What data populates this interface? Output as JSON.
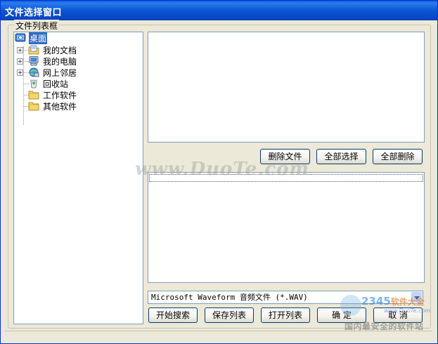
{
  "window": {
    "title": "文件选择窗口"
  },
  "group": {
    "label": "文件列表框"
  },
  "tree": {
    "items": [
      {
        "label": "桌面",
        "icon": "desktop-icon",
        "selected": true
      },
      {
        "label": "我的文档",
        "icon": "documents-folder-icon",
        "expandable": true
      },
      {
        "label": "我的电脑",
        "icon": "computer-icon",
        "expandable": true
      },
      {
        "label": "网上邻居",
        "icon": "network-icon",
        "expandable": true
      },
      {
        "label": "回收站",
        "icon": "recycle-bin-icon"
      },
      {
        "label": "工作软件",
        "icon": "folder-icon"
      },
      {
        "label": "其他软件",
        "icon": "folder-icon"
      }
    ]
  },
  "list_actions": {
    "delete_file": "删除文件",
    "select_all": "全部选择",
    "delete_all": "全部删除"
  },
  "filetype": {
    "selected": "Microsoft Waveform 音频文件 (*.WAV)"
  },
  "bottom_actions": {
    "start_search": "开始搜索",
    "save_list": "保存列表",
    "open_list": "打开列表",
    "ok": "确  定",
    "cancel": "取  消"
  },
  "watermarks": {
    "main": "www.DuoTe.com",
    "brand": "2345",
    "brand_suffix": "软件大全",
    "url": "www.DuoTe.com",
    "slogan": "国内最安全的软件站"
  }
}
